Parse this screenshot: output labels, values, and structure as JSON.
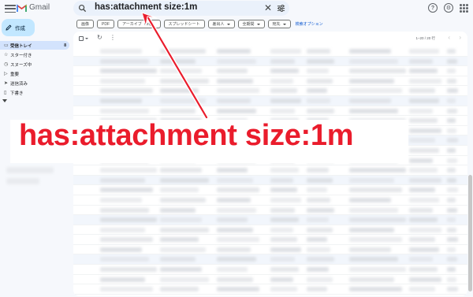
{
  "app": {
    "title": "Gmail"
  },
  "search": {
    "query": "has:attachment size:1m",
    "clear_glyph": "✕"
  },
  "compose": {
    "label": "作成"
  },
  "sidebar": {
    "items": [
      {
        "icon": "inbox-icon",
        "glyph": "▭",
        "label": "受信トレイ",
        "count": "8"
      },
      {
        "icon": "star-icon",
        "glyph": "☆",
        "label": "スター付き",
        "count": ""
      },
      {
        "icon": "clock-icon",
        "glyph": "◷",
        "label": "スヌーズ中",
        "count": ""
      },
      {
        "icon": "important-icon",
        "glyph": "▷",
        "label": "重要",
        "count": ""
      },
      {
        "icon": "send-icon",
        "glyph": "➤",
        "label": "送信済み",
        "count": ""
      },
      {
        "icon": "draft-icon",
        "glyph": "▯",
        "label": "下書き",
        "count": ""
      }
    ]
  },
  "filters": {
    "chips": [
      {
        "label": "画像",
        "dropdown": false
      },
      {
        "label": "PDF",
        "dropdown": false
      },
      {
        "label": "アーカイブ（.zip）",
        "dropdown": false
      },
      {
        "label": "スプレッドシート",
        "dropdown": false
      },
      {
        "label": "差出人",
        "dropdown": true
      },
      {
        "label": "全期間",
        "dropdown": true
      },
      {
        "label": "宛先",
        "dropdown": true
      }
    ],
    "advanced_label": "検索オプション"
  },
  "toolbar": {
    "pagination": "1–20 / 20 行",
    "refresh_glyph": "↻",
    "more_glyph": "⋮",
    "prev_glyph": "‹",
    "next_glyph": "›"
  },
  "overlay": {
    "text": "has:attachment size:1m",
    "color": "#ea1c2c"
  },
  "colors": {
    "accent": "#c2e7ff",
    "active_nav": "#d3e3fd",
    "search_bg": "#eaf1fb",
    "link": "#0b57d0"
  }
}
